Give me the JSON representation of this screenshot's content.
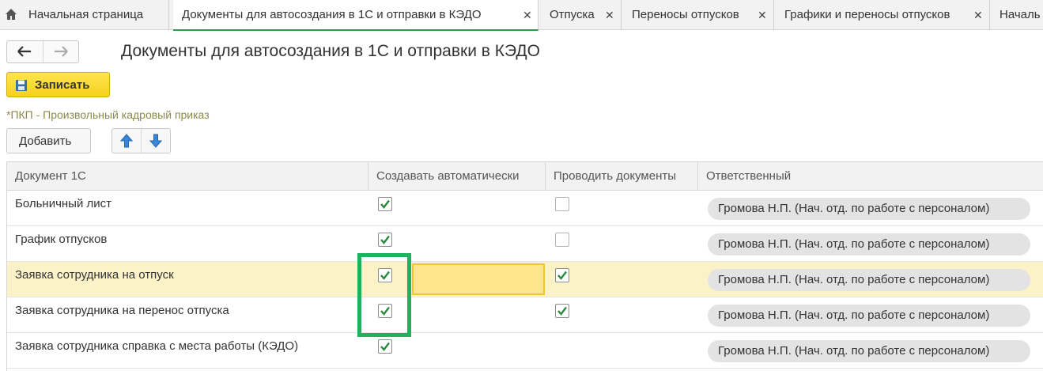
{
  "tabs": [
    {
      "label": "Начальная страница",
      "icon": "home-icon",
      "closable": false,
      "active": false
    },
    {
      "label": "Документы для автосоздания в 1С и отправки в КЭДО",
      "closable": true,
      "active": true
    },
    {
      "label": "Отпуска",
      "closable": true,
      "active": false
    },
    {
      "label": "Переносы отпусков",
      "closable": true,
      "active": false
    },
    {
      "label": "Графики и переносы отпусков",
      "closable": true,
      "active": false
    },
    {
      "label": "Началь",
      "closable": false,
      "active": false
    }
  ],
  "tab_close_glyph": "✕",
  "page_title": "Документы для автосоздания в 1С и отправки в КЭДО",
  "toolbar": {
    "save_label": "Записать",
    "back_icon": "arrow-left-icon",
    "forward_icon": "arrow-right-icon"
  },
  "subtitle": "*ПКП - Произвольный кадровый приказ",
  "list_toolbar": {
    "add_label": "Добавить",
    "up_icon": "arrow-up-icon",
    "down_icon": "arrow-down-icon"
  },
  "table": {
    "columns": [
      "Документ 1С",
      "Создавать автоматически",
      "Проводить документы",
      "Ответственный"
    ],
    "rows": [
      {
        "document": "Больничный лист",
        "auto_create": true,
        "post": false,
        "responsible": "Громова Н.П. (Нач. отд. по работе с персоналом)"
      },
      {
        "document": "График отпусков",
        "auto_create": true,
        "post": false,
        "responsible": "Громова Н.П. (Нач. отд. по работе с персоналом)"
      },
      {
        "document": "Заявка сотрудника на отпуск",
        "auto_create": true,
        "post": true,
        "responsible": "Громова Н.П. (Нач. отд. по работе с персоналом)",
        "selected": true
      },
      {
        "document": "Заявка сотрудника на перенос отпуска",
        "auto_create": true,
        "post": true,
        "responsible": "Громова Н.П. (Нач. отд. по работе с персоналом)"
      },
      {
        "document": "Заявка сотрудника справка с места работы (КЭДО)",
        "auto_create": true,
        "post": null,
        "responsible": "Громова Н.П. (Нач. отд. по работе с персоналом)"
      }
    ]
  },
  "colors": {
    "accent_green": "#2e9b4e",
    "highlight_green": "#20b15e",
    "save_yellow": "#f5d21f",
    "selected_row": "#fbf2c7",
    "check_green": "#2a8a3e"
  }
}
